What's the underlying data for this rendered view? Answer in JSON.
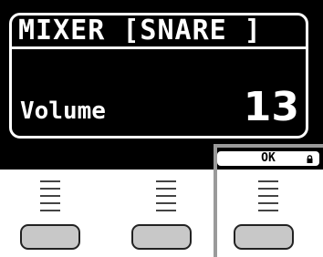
{
  "display": {
    "title": "MIXER [SNARE ]",
    "param_label": "Volume",
    "param_value": "13"
  },
  "soft_keys": [
    {
      "label": ""
    },
    {
      "label": ""
    },
    {
      "label": "OK"
    }
  ],
  "icons": {
    "ok_indicator": "lock-icon"
  },
  "colors": {
    "screen_bg": "#000000",
    "screen_fg": "#ffffff",
    "button_face": "#c8c8c8",
    "callout": "#9a9a9a"
  }
}
